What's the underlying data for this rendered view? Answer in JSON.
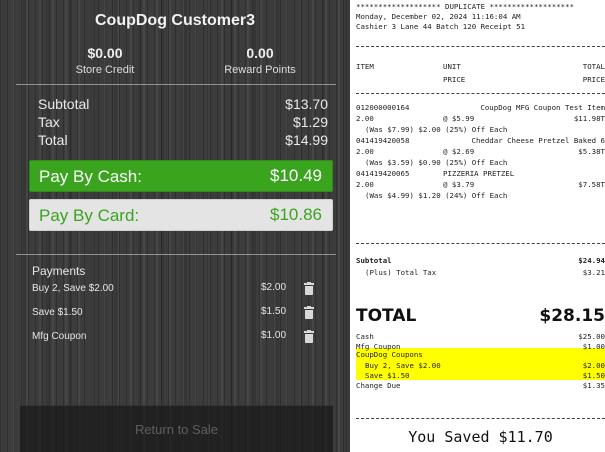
{
  "pos": {
    "customer_title": "CoupDog Customer3",
    "store_credit": {
      "value": "$0.00",
      "label": "Store Credit"
    },
    "reward_points": {
      "value": "0.00",
      "label": "Reward Points"
    },
    "totals": [
      {
        "label": "Subtotal",
        "value": "$13.70"
      },
      {
        "label": "Tax",
        "value": "$1.29"
      },
      {
        "label": "Total",
        "value": "$14.99"
      }
    ],
    "pay_cash": {
      "label": "Pay By Cash:",
      "amount": "$10.49"
    },
    "pay_card": {
      "label": "Pay By Card:",
      "amount": "$10.86"
    },
    "payments_heading": "Payments",
    "payments": [
      {
        "label": "Buy 2, Save $2.00",
        "amount": "$2.00"
      },
      {
        "label": "Save $1.50",
        "amount": "$1.50"
      },
      {
        "label": "Mfg Coupon",
        "amount": "$1.00"
      }
    ],
    "return_button": "Return to Sale",
    "colors": {
      "accent_green": "#3aa41f",
      "card_bg": "#e4e4e4"
    }
  },
  "receipt": {
    "banner": "******************* DUPLICATE *******************",
    "date_line": "Monday, December 02, 2024 11:16:04 AM",
    "cashier_line": "Cashier 3 Lane 44 Batch 120 Receipt 51",
    "col_item": "ITEM",
    "col_unit_1": "UNIT",
    "col_unit_2": "PRICE",
    "col_total_1": "TOTAL",
    "col_total_2": "PRICE",
    "items": [
      {
        "sku": "012000000164",
        "desc": "CoupDog MFG Coupon Test Item",
        "qty": "2.00",
        "unit": "@ $5.99",
        "total": "$11.98T",
        "saving": "(Was $7.99) $2.00 (25%) Off Each"
      },
      {
        "sku": "041419420058",
        "desc": "Cheddar Cheese Pretzel Baked 6",
        "qty": "2.00",
        "unit": "@ $2.69",
        "total": "$5.38T",
        "saving": "(Was $3.59) $0.90 (25%) Off Each"
      },
      {
        "sku": "041419420065",
        "desc": "PIZZERIA PRETZEL",
        "qty": "2.00",
        "unit": "@ $3.79",
        "total": "$7.58T",
        "saving": "(Was $4.99) $1.20 (24%) Off Each"
      }
    ],
    "subtotal": {
      "label": "Subtotal",
      "value": "$24.94"
    },
    "tax": {
      "label": "(Plus) Total Tax",
      "value": "$3.21"
    },
    "grand_total": {
      "label": "TOTAL",
      "value": "$28.15"
    },
    "tenders": [
      {
        "label": "Cash",
        "value": "$25.00"
      },
      {
        "label": "Mfg Coupon",
        "value": "$1.00"
      }
    ],
    "coupdog_coupons": {
      "label": "CoupDog Coupons",
      "lines": [
        {
          "label": "Buy 2, Save $2.00",
          "value": "$2.00"
        },
        {
          "label": "Save $1.50",
          "value": "$1.50"
        }
      ]
    },
    "change_due": {
      "label": "Change Due",
      "value": "$1.35"
    },
    "you_saved": "You Saved $11.70",
    "highlight_color": "#ffff00"
  }
}
